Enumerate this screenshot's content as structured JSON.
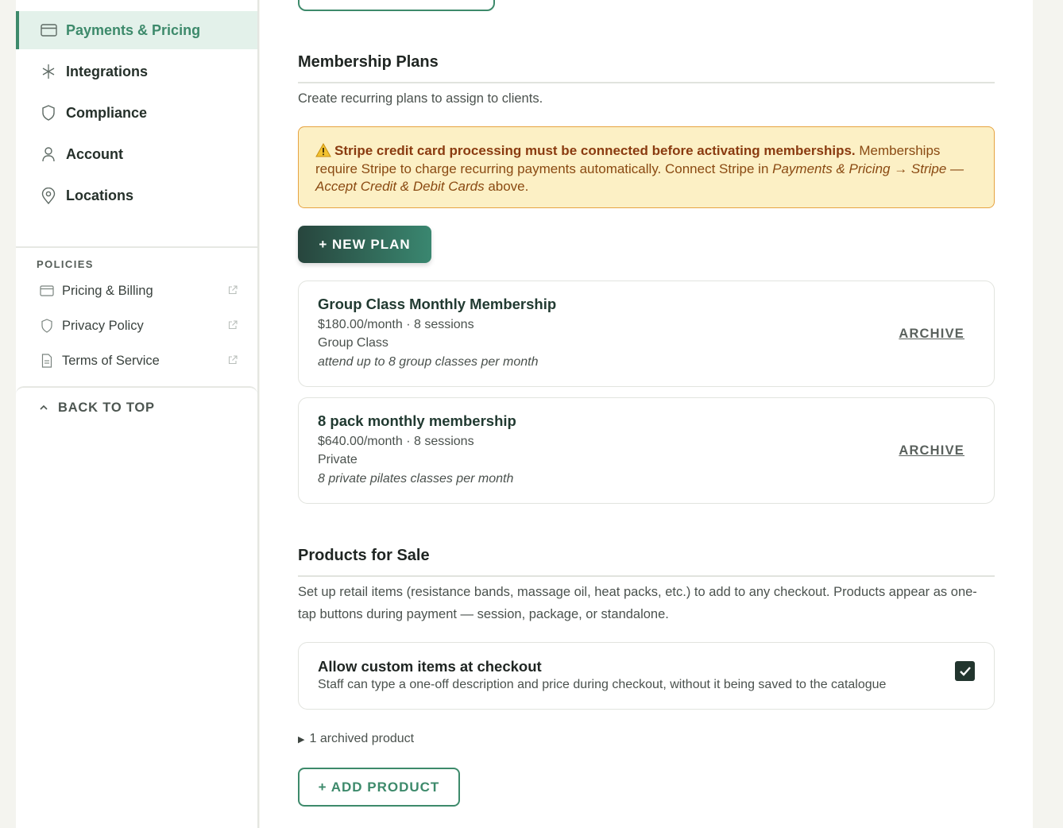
{
  "sidebar": {
    "items": [
      {
        "label": "Payments & Pricing",
        "icon": "credit-card-icon",
        "active": true
      },
      {
        "label": "Integrations",
        "icon": "sparkle-icon"
      },
      {
        "label": "Compliance",
        "icon": "shield-icon"
      },
      {
        "label": "Account",
        "icon": "user-icon"
      },
      {
        "label": "Locations",
        "icon": "map-pin-icon"
      }
    ],
    "policies_heading": "POLICIES",
    "policies": [
      {
        "label": "Pricing & Billing",
        "icon": "credit-card-icon"
      },
      {
        "label": "Privacy Policy",
        "icon": "shield-icon"
      },
      {
        "label": "Terms of Service",
        "icon": "document-icon"
      }
    ],
    "back_to_top": "BACK TO TOP"
  },
  "membership": {
    "title": "Membership Plans",
    "description": "Create recurring plans to assign to clients.",
    "alert": {
      "icon": "warning-icon",
      "bold": "Stripe credit card processing must be connected before activating memberships.",
      "text1": " Memberships require Stripe to charge recurring payments automatically. Connect Stripe in ",
      "link_italic": "Payments & Pricing → Stripe — Accept Credit & Debit Cards",
      "text2": " above."
    },
    "new_plan_button": "+ NEW PLAN",
    "plans": [
      {
        "name": "Group Class Monthly Membership",
        "price": "$180.00/month · 8 sessions",
        "type": "Group Class",
        "note": "attend up to 8 group classes per month",
        "action": "ARCHIVE"
      },
      {
        "name": "8 pack monthly membership",
        "price": "$640.00/month · 8 sessions",
        "type": "Private",
        "note": "8 private pilates classes per month",
        "action": "ARCHIVE"
      }
    ]
  },
  "products": {
    "title": "Products for Sale",
    "description": "Set up retail items (resistance bands, massage oil, heat packs, etc.) to add to any checkout. Products appear as one-tap buttons during payment — session, package, or standalone.",
    "custom_items": {
      "title": "Allow custom items at checkout",
      "subtitle": "Staff can type a one-off description and price during checkout, without it being saved to the catalogue",
      "checked": true
    },
    "archived_toggle": "1 archived product",
    "add_button": "+ ADD PRODUCT"
  },
  "colors": {
    "accent": "#3d8a6b",
    "alert_bg": "#fcf0c5",
    "alert_border": "#e6a341"
  }
}
